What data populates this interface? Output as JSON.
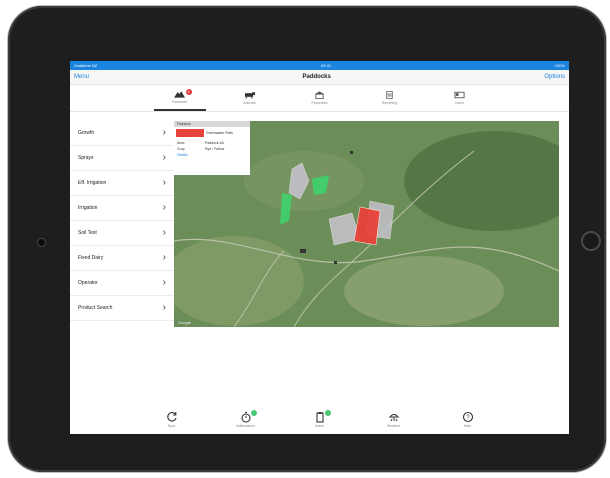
{
  "statusbar": {
    "carrier": "Vodafone NZ",
    "time": "09:41",
    "battery": "100%"
  },
  "navbar": {
    "left": "Menu",
    "title": "Paddocks",
    "right": "Options"
  },
  "tabs": [
    {
      "label": "Paddocks",
      "icon": "hill-icon",
      "badge": "2",
      "active": true
    },
    {
      "label": "Animals",
      "icon": "cow-icon",
      "active": false
    },
    {
      "label": "Properties",
      "icon": "farm-building-icon",
      "active": false
    },
    {
      "label": "Reporting",
      "icon": "report-icon",
      "active": false
    },
    {
      "label": "Users",
      "icon": "id-card-icon",
      "active": false
    }
  ],
  "sidebar": {
    "items": [
      {
        "label": "Growth"
      },
      {
        "label": "Sprays"
      },
      {
        "label": "Eff. Irrigation"
      },
      {
        "label": "Irrigation"
      },
      {
        "label": "Soil Test"
      },
      {
        "label": "Fixed Dairy"
      },
      {
        "label": "Operator"
      },
      {
        "label": "Product Search"
      }
    ]
  },
  "map": {
    "popup": {
      "header": "Paddock",
      "name": "Greenwater Flats",
      "row1_label": "Area",
      "row1_value": "Paddock 4A",
      "row2_label": "Crop",
      "row2_value": "Rye / Fallow",
      "footer": "Details"
    },
    "watermark": "Google",
    "colors": {
      "selected": "#e8433a",
      "green": "#3fd06b",
      "grey": "#c9c4d1"
    }
  },
  "bottom": [
    {
      "label": "Sync",
      "icon": "refresh-icon"
    },
    {
      "label": "Notifications",
      "icon": "stopwatch-icon",
      "dot": true
    },
    {
      "label": "Notes",
      "icon": "clipboard-icon",
      "dot": true
    },
    {
      "label": "Weather",
      "icon": "rain-icon"
    },
    {
      "label": "Help",
      "icon": "help-icon"
    }
  ]
}
